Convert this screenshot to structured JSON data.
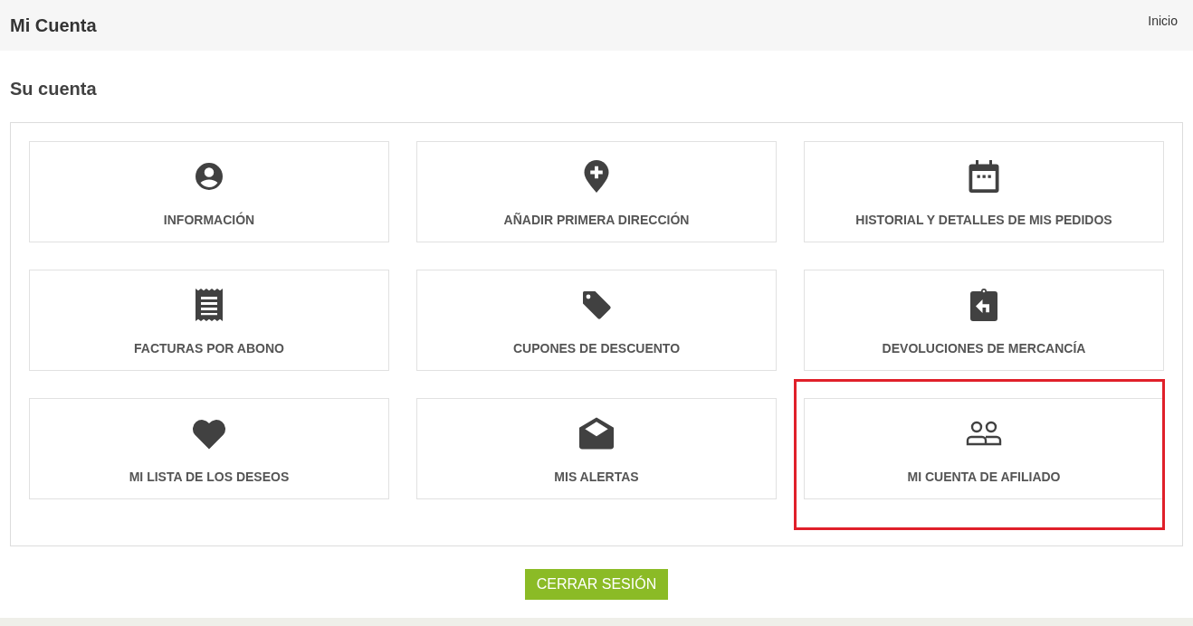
{
  "header": {
    "title": "Mi Cuenta",
    "breadcrumb": "Inicio"
  },
  "section_title": "Su cuenta",
  "tiles": [
    {
      "label": "INFORMACIÓN",
      "highlighted": false
    },
    {
      "label": "AÑADIR PRIMERA DIRECCIÓN",
      "highlighted": false
    },
    {
      "label": "HISTORIAL Y DETALLES DE MIS PEDIDOS",
      "highlighted": false
    },
    {
      "label": "FACTURAS POR ABONO",
      "highlighted": false
    },
    {
      "label": "CUPONES DE DESCUENTO",
      "highlighted": false
    },
    {
      "label": "DEVOLUCIONES DE MERCANCÍA",
      "highlighted": false
    },
    {
      "label": "MI LISTA DE LOS DESEOS",
      "highlighted": false
    },
    {
      "label": "MIS ALERTAS",
      "highlighted": false
    },
    {
      "label": "MI CUENTA DE AFILIADO",
      "highlighted": true
    }
  ],
  "logout_button": "CERRAR SESIÓN"
}
